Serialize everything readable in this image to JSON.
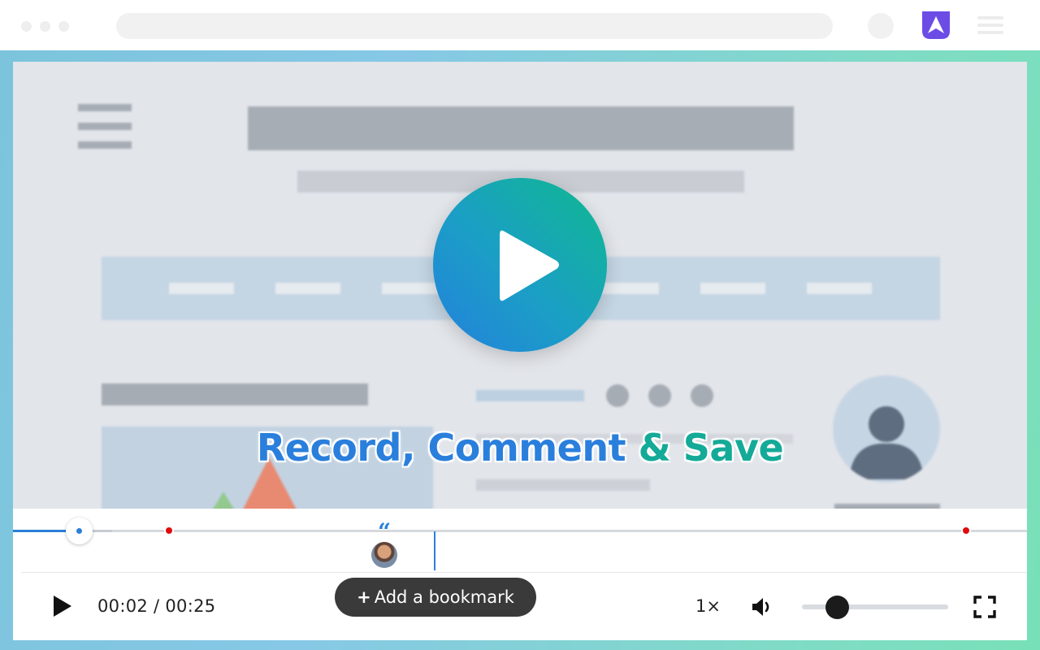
{
  "browser": {
    "icons": [
      "traffic-lights",
      "address-bar",
      "profile-circle",
      "extension-logo-icon",
      "menu-icon"
    ],
    "brand_color": "#6b4de6"
  },
  "video": {
    "headline_part1": "Record, Comment",
    "headline_amp": "&",
    "headline_part2": "Save",
    "play_button": "play-icon",
    "gradient": [
      "#0fb98f",
      "#2380dc"
    ]
  },
  "player": {
    "current_time": "00:02",
    "separator": "/",
    "duration": "00:25",
    "progress_fraction": 0.08,
    "bookmark_plus": "+",
    "bookmark_label": "Add a bookmark",
    "speed_label": "1×",
    "volume_level": 0.2,
    "accent_color": "#2b7fd8",
    "marker_color": "#e10b0b"
  }
}
